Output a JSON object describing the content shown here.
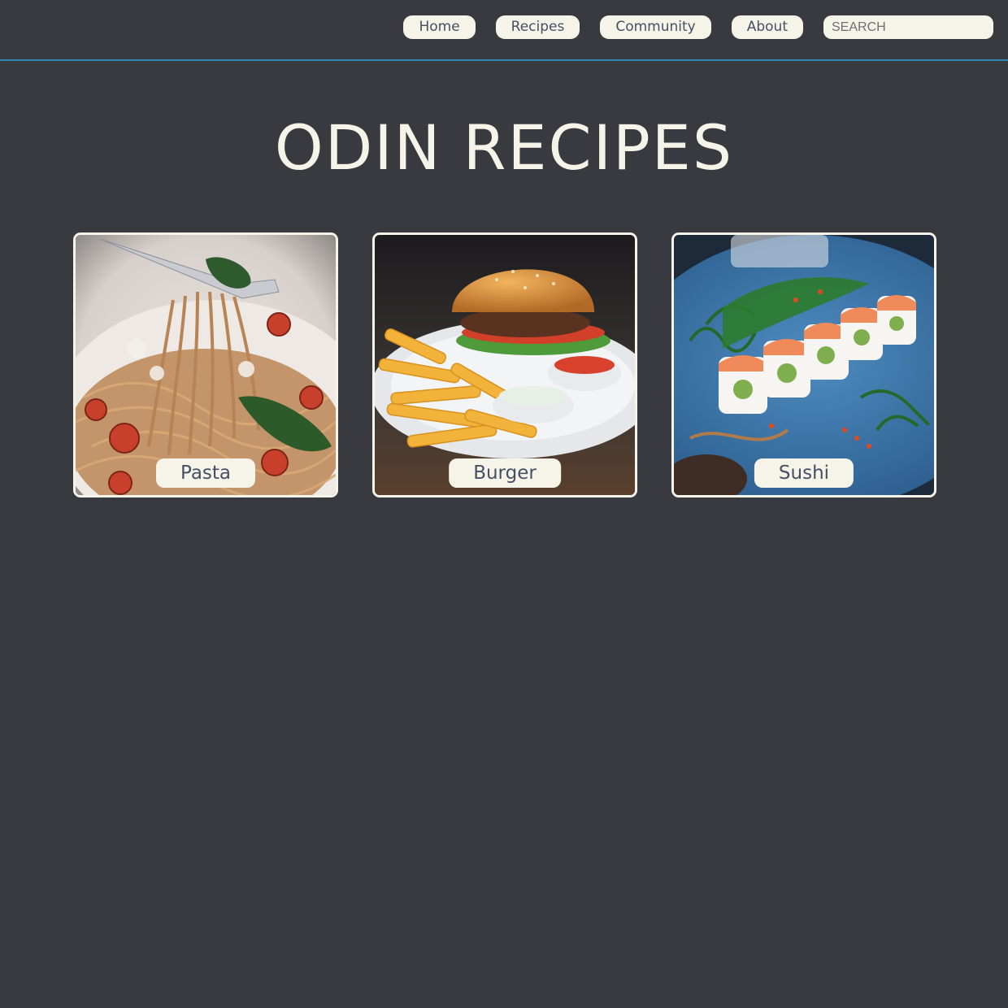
{
  "nav": {
    "items": [
      {
        "label": "Home"
      },
      {
        "label": "Recipes"
      },
      {
        "label": "Community"
      },
      {
        "label": "About"
      }
    ],
    "search_placeholder": "SEARCH"
  },
  "page": {
    "title": "ODIN RECIPES"
  },
  "recipes": [
    {
      "label": "Pasta",
      "image": "pasta-photo"
    },
    {
      "label": "Burger",
      "image": "burger-photo"
    },
    {
      "label": "Sushi",
      "image": "sushi-photo"
    }
  ],
  "colors": {
    "background": "#393a40",
    "accent_line": "#2f86b4",
    "cream": "#f6f3e8",
    "text_dark": "#455066"
  }
}
